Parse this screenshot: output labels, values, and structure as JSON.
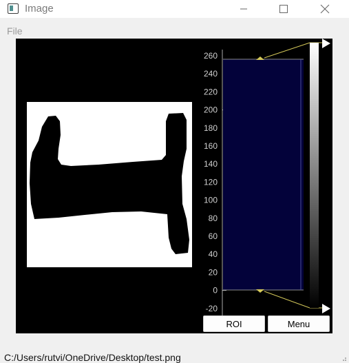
{
  "window": {
    "title": "Image",
    "icons": {
      "app": "image-window-icon",
      "minimize": "minimize-icon",
      "maximize": "maximize-icon",
      "close": "close-icon"
    }
  },
  "menubar": {
    "file_label": "File"
  },
  "histogram": {
    "axis_ticks": [
      "260",
      "240",
      "220",
      "200",
      "180",
      "160",
      "140",
      "120",
      "100",
      "80",
      "60",
      "40",
      "20",
      "0",
      "-20"
    ],
    "level_min": 0,
    "level_max": 255,
    "region_color": "#03023a",
    "handle_color": "#d4c85a"
  },
  "buttons": {
    "roi_label": "ROI",
    "menu_label": "Menu"
  },
  "status": {
    "path": "C:/Users/rutvi/OneDrive/Desktop/test.png"
  },
  "colors": {
    "background": "#f0f0f0",
    "image_area": "#000000"
  }
}
